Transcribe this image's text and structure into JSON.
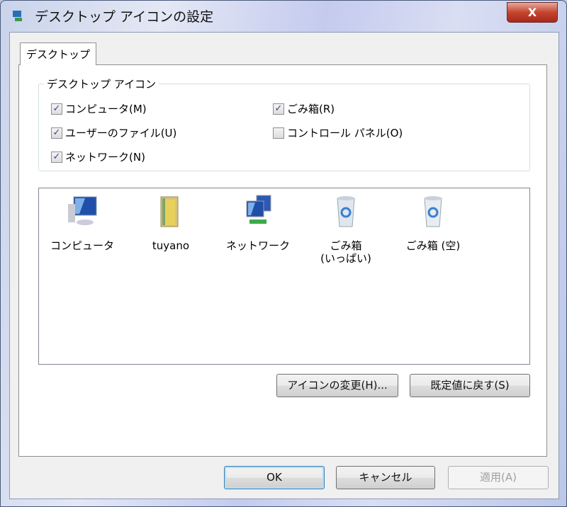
{
  "window": {
    "title": "デスクトップ アイコンの設定",
    "close_label": "X"
  },
  "tabs": [
    {
      "label": "デスクトップ"
    }
  ],
  "group": {
    "label": "デスクトップ アイコン",
    "checkboxes": [
      {
        "label": "コンピュータ(M)",
        "checked": true
      },
      {
        "label": "ごみ箱(R)",
        "checked": true
      },
      {
        "label": "ユーザーのファイル(U)",
        "checked": true
      },
      {
        "label": "コントロール パネル(O)",
        "checked": false
      },
      {
        "label": "ネットワーク(N)",
        "checked": true
      }
    ]
  },
  "icons": [
    {
      "label": "コンピュータ",
      "icon": "computer-icon"
    },
    {
      "label": "tuyano",
      "icon": "user-folder-icon"
    },
    {
      "label": "ネットワーク",
      "icon": "network-icon"
    },
    {
      "label": "ごみ箱\n(いっぱい)",
      "icon": "recycle-bin-full-icon"
    },
    {
      "label": "ごみ箱 (空)",
      "icon": "recycle-bin-empty-icon"
    }
  ],
  "buttons": {
    "change_icon": "アイコンの変更(H)...",
    "restore_default": "既定値に戻す(S)",
    "ok": "OK",
    "cancel": "キャンセル",
    "apply": "適用(A)"
  },
  "check_mark": "✓"
}
